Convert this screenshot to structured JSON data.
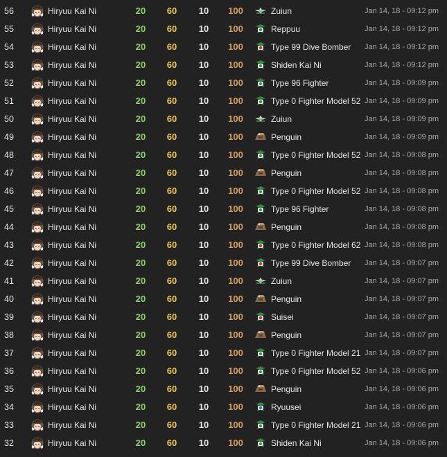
{
  "ship_name": "Hiryuu Kai Ni",
  "colors": {
    "fuel": "#8fd46a",
    "ammo": "#f2c84e",
    "steel": "#e6e6e6",
    "bauxite": "#d9a05a"
  },
  "rows": [
    {
      "id": "56",
      "ship": "Hiryuu Kai Ni",
      "fuel": "20",
      "ammo": "60",
      "steel": "10",
      "bauxite": "100",
      "equip_icon": "seaplane-icon",
      "equip": "Zuiun",
      "time": "Jan 14, 18 - 09:12 pm"
    },
    {
      "id": "55",
      "ship": "Hiryuu Kai Ni",
      "fuel": "20",
      "ammo": "60",
      "steel": "10",
      "bauxite": "100",
      "equip_icon": "fighter-icon",
      "equip": "Reppuu",
      "time": "Jan 14, 18 - 09:12 pm"
    },
    {
      "id": "54",
      "ship": "Hiryuu Kai Ni",
      "fuel": "20",
      "ammo": "60",
      "steel": "10",
      "bauxite": "100",
      "equip_icon": "dive-bomber-icon",
      "equip": "Type 99 Dive Bomber",
      "time": "Jan 14, 18 - 09:12 pm"
    },
    {
      "id": "53",
      "ship": "Hiryuu Kai Ni",
      "fuel": "20",
      "ammo": "60",
      "steel": "10",
      "bauxite": "100",
      "equip_icon": "fighter-icon",
      "equip": "Shiden Kai Ni",
      "time": "Jan 14, 18 - 09:12 pm"
    },
    {
      "id": "52",
      "ship": "Hiryuu Kai Ni",
      "fuel": "20",
      "ammo": "60",
      "steel": "10",
      "bauxite": "100",
      "equip_icon": "fighter-icon",
      "equip": "Type 96 Fighter",
      "time": "Jan 14, 18 - 09:09 pm"
    },
    {
      "id": "51",
      "ship": "Hiryuu Kai Ni",
      "fuel": "20",
      "ammo": "60",
      "steel": "10",
      "bauxite": "100",
      "equip_icon": "fighter-icon",
      "equip": "Type 0 Fighter Model 52",
      "time": "Jan 14, 18 - 09:09 pm"
    },
    {
      "id": "50",
      "ship": "Hiryuu Kai Ni",
      "fuel": "20",
      "ammo": "60",
      "steel": "10",
      "bauxite": "100",
      "equip_icon": "seaplane-icon",
      "equip": "Zuiun",
      "time": "Jan 14, 18 - 09:09 pm"
    },
    {
      "id": "49",
      "ship": "Hiryuu Kai Ni",
      "fuel": "20",
      "ammo": "60",
      "steel": "10",
      "bauxite": "100",
      "equip_icon": "penguin-icon",
      "equip": "Penguin",
      "time": "Jan 14, 18 - 09:09 pm"
    },
    {
      "id": "48",
      "ship": "Hiryuu Kai Ni",
      "fuel": "20",
      "ammo": "60",
      "steel": "10",
      "bauxite": "100",
      "equip_icon": "fighter-icon",
      "equip": "Type 0 Fighter Model 52",
      "time": "Jan 14, 18 - 09:08 pm"
    },
    {
      "id": "47",
      "ship": "Hiryuu Kai Ni",
      "fuel": "20",
      "ammo": "60",
      "steel": "10",
      "bauxite": "100",
      "equip_icon": "penguin-icon",
      "equip": "Penguin",
      "time": "Jan 14, 18 - 09:08 pm"
    },
    {
      "id": "46",
      "ship": "Hiryuu Kai Ni",
      "fuel": "20",
      "ammo": "60",
      "steel": "10",
      "bauxite": "100",
      "equip_icon": "fighter-icon",
      "equip": "Type 0 Fighter Model 52",
      "time": "Jan 14, 18 - 09:08 pm"
    },
    {
      "id": "45",
      "ship": "Hiryuu Kai Ni",
      "fuel": "20",
      "ammo": "60",
      "steel": "10",
      "bauxite": "100",
      "equip_icon": "fighter-icon",
      "equip": "Type 96 Fighter",
      "time": "Jan 14, 18 - 09:08 pm"
    },
    {
      "id": "44",
      "ship": "Hiryuu Kai Ni",
      "fuel": "20",
      "ammo": "60",
      "steel": "10",
      "bauxite": "100",
      "equip_icon": "penguin-icon",
      "equip": "Penguin",
      "time": "Jan 14, 18 - 09:08 pm"
    },
    {
      "id": "43",
      "ship": "Hiryuu Kai Ni",
      "fuel": "20",
      "ammo": "60",
      "steel": "10",
      "bauxite": "100",
      "equip_icon": "dive-bomber-icon",
      "equip": "Type 0 Fighter Model 62",
      "time": "Jan 14, 18 - 09:08 pm"
    },
    {
      "id": "42",
      "ship": "Hiryuu Kai Ni",
      "fuel": "20",
      "ammo": "60",
      "steel": "10",
      "bauxite": "100",
      "equip_icon": "dive-bomber-icon",
      "equip": "Type 99 Dive Bomber",
      "time": "Jan 14, 18 - 09:07 pm"
    },
    {
      "id": "41",
      "ship": "Hiryuu Kai Ni",
      "fuel": "20",
      "ammo": "60",
      "steel": "10",
      "bauxite": "100",
      "equip_icon": "seaplane-icon",
      "equip": "Zuiun",
      "time": "Jan 14, 18 - 09:07 pm"
    },
    {
      "id": "40",
      "ship": "Hiryuu Kai Ni",
      "fuel": "20",
      "ammo": "60",
      "steel": "10",
      "bauxite": "100",
      "equip_icon": "penguin-icon",
      "equip": "Penguin",
      "time": "Jan 14, 18 - 09:07 pm"
    },
    {
      "id": "39",
      "ship": "Hiryuu Kai Ni",
      "fuel": "20",
      "ammo": "60",
      "steel": "10",
      "bauxite": "100",
      "equip_icon": "dive-bomber-icon",
      "equip": "Suisei",
      "time": "Jan 14, 18 - 09:07 pm"
    },
    {
      "id": "38",
      "ship": "Hiryuu Kai Ni",
      "fuel": "20",
      "ammo": "60",
      "steel": "10",
      "bauxite": "100",
      "equip_icon": "penguin-icon",
      "equip": "Penguin",
      "time": "Jan 14, 18 - 09:07 pm"
    },
    {
      "id": "37",
      "ship": "Hiryuu Kai Ni",
      "fuel": "20",
      "ammo": "60",
      "steel": "10",
      "bauxite": "100",
      "equip_icon": "fighter-icon",
      "equip": "Type 0 Fighter Model 21",
      "time": "Jan 14, 18 - 09:07 pm"
    },
    {
      "id": "36",
      "ship": "Hiryuu Kai Ni",
      "fuel": "20",
      "ammo": "60",
      "steel": "10",
      "bauxite": "100",
      "equip_icon": "fighter-icon",
      "equip": "Type 0 Fighter Model 52",
      "time": "Jan 14, 18 - 09:06 pm"
    },
    {
      "id": "35",
      "ship": "Hiryuu Kai Ni",
      "fuel": "20",
      "ammo": "60",
      "steel": "10",
      "bauxite": "100",
      "equip_icon": "penguin-icon",
      "equip": "Penguin",
      "time": "Jan 14, 18 - 09:06 pm"
    },
    {
      "id": "34",
      "ship": "Hiryuu Kai Ni",
      "fuel": "20",
      "ammo": "60",
      "steel": "10",
      "bauxite": "100",
      "equip_icon": "torpedo-bomber-icon",
      "equip": "Ryuusei",
      "time": "Jan 14, 18 - 09:06 pm"
    },
    {
      "id": "33",
      "ship": "Hiryuu Kai Ni",
      "fuel": "20",
      "ammo": "60",
      "steel": "10",
      "bauxite": "100",
      "equip_icon": "fighter-icon",
      "equip": "Type 0 Fighter Model 21",
      "time": "Jan 14, 18 - 09:06 pm"
    },
    {
      "id": "32",
      "ship": "Hiryuu Kai Ni",
      "fuel": "20",
      "ammo": "60",
      "steel": "10",
      "bauxite": "100",
      "equip_icon": "fighter-icon",
      "equip": "Shiden Kai Ni",
      "time": "Jan 14, 18 - 09:06 pm"
    }
  ]
}
